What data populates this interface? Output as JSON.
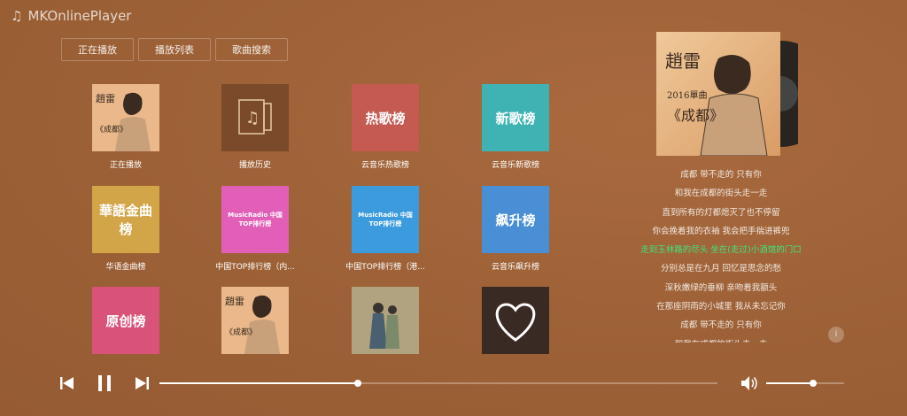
{
  "app": {
    "title": "MKOnlinePlayer",
    "icon": "music-note-icon"
  },
  "tabs": [
    {
      "label": "正在播放"
    },
    {
      "label": "播放列表"
    },
    {
      "label": "歌曲搜索"
    }
  ],
  "playlists": [
    {
      "title": "正在播放",
      "cover": "album-art"
    },
    {
      "title": "播放历史",
      "cover": "history-icon",
      "color": "#7a4a2a"
    },
    {
      "title": "云音乐热歌榜",
      "cover_text": "热歌榜",
      "color": "#c45a50"
    },
    {
      "title": "云音乐新歌榜",
      "cover_text": "新歌榜",
      "color": "#3fb3b3"
    },
    {
      "title": "华语金曲榜",
      "cover_text": "華語金曲榜",
      "color": "#d2a548"
    },
    {
      "title": "中国TOP排行榜（内...",
      "cover_text": "MusicRadio 中国TOP排行榜",
      "color": "#e25fb8"
    },
    {
      "title": "中国TOP排行榜（港...",
      "cover_text": "MusicRadio 中国TOP排行榜",
      "color": "#3b9bdd"
    },
    {
      "title": "云音乐飙升榜",
      "cover_text": "飙升榜",
      "color": "#4a8fd6"
    },
    {
      "title": "",
      "cover_text": "原创榜",
      "color": "#d9527a"
    },
    {
      "title": "",
      "cover": "album-art"
    },
    {
      "title": "",
      "cover": "couple-illustration",
      "color": "#9c8a6a"
    },
    {
      "title": "",
      "cover": "heart-icon",
      "color": "#3a2a24"
    }
  ],
  "now_playing": {
    "album_cover": "album-art"
  },
  "lyrics": [
    "成都 带不走的 只有你",
    "和我在成都的街头走一走",
    "直到所有的灯都熄灭了也不停留",
    "你会挽着我的衣袖 我会把手揣进裤兜",
    "走到玉林路的尽头 坐在(走过)小酒馆的门口",
    "分别总是在九月 回忆是思念的愁",
    "深秋嫩绿的垂柳 亲吻着我额头",
    "在那座阴雨的小城里 我从未忘记你",
    "成都 带不走的 只有你",
    "和我在成都的街头走一走"
  ],
  "current_lyric_index": 4,
  "player": {
    "progress": 0.355,
    "volume": 0.6,
    "state": "playing"
  },
  "colors": {
    "background": "#a0643a",
    "accent": "#3fe67a"
  }
}
